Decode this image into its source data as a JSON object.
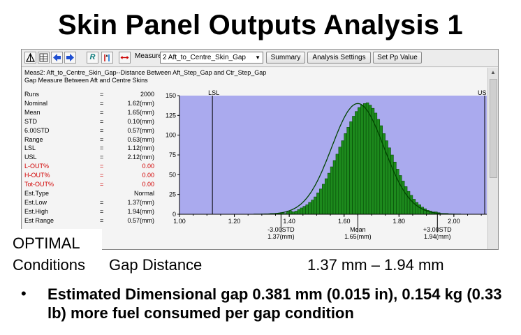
{
  "slide": {
    "title": "Skin Panel Outputs Analysis 1",
    "optimal_line1": "OPTIMAL",
    "optimal_line2": "Conditions",
    "gap_label": "Gap Distance",
    "gap_range": "1.37 mm – 1.94 mm",
    "bullet": "Estimated Dimensional gap 0.381 mm (0.015 in), 0.154 kg (0.33 lb) more fuel consumed per gap condition"
  },
  "toolbar": {
    "icons": [
      "histogram-icon",
      "table-icon",
      "arrow-left-icon",
      "arrow-right-icon",
      "r-icon",
      "bars-arrow-icon",
      "spread-arrows-icon"
    ],
    "measure_label": "Measure:",
    "measure_value": "2 Aft_to_Centre_Skin_Gap",
    "summary_label": "Summary",
    "analysis_settings_label": "Analysis Settings",
    "set_pp_label": "Set Pp Value"
  },
  "measure": {
    "line1": "Meas2: Aft_to_Centre_Skin_Gap--Distance Between Aft_Step_Gap and Ctr_Step_Gap",
    "line2": "Gap Measure Between Aft and Centre Skins"
  },
  "stats": [
    {
      "label": "Runs",
      "eq": "=",
      "value": "2000",
      "color": "black"
    },
    {
      "label": "Nominal",
      "eq": "=",
      "value": "1.62(mm)",
      "color": "black"
    },
    {
      "label": "Mean",
      "eq": "=",
      "value": "1.65(mm)",
      "color": "black"
    },
    {
      "label": "STD",
      "eq": "=",
      "value": "0.10(mm)",
      "color": "black"
    },
    {
      "label": "6.00STD",
      "eq": "=",
      "value": "0.57(mm)",
      "color": "black"
    },
    {
      "label": "Range",
      "eq": "=",
      "value": "0.63(mm)",
      "color": "black"
    },
    {
      "label": "LSL",
      "eq": "=",
      "value": "1.12(mm)",
      "color": "black"
    },
    {
      "label": "USL",
      "eq": "=",
      "value": "2.12(mm)",
      "color": "black"
    },
    {
      "label": "L-OUT%",
      "eq": "=",
      "value": "0.00",
      "color": "red"
    },
    {
      "label": "H-OUT%",
      "eq": "=",
      "value": "0.00",
      "color": "red"
    },
    {
      "label": "Tot-OUT%",
      "eq": "=",
      "value": "0.00",
      "color": "red"
    },
    {
      "label": "Est.Type",
      "eq": "",
      "value": "Normal",
      "color": "black"
    },
    {
      "label": "Est.Low",
      "eq": "=",
      "value": "1.37(mm)",
      "color": "black"
    },
    {
      "label": "Est.High",
      "eq": "=",
      "value": "1.94(mm)",
      "color": "black"
    },
    {
      "label": "Est Range",
      "eq": "=",
      "value": "0.57(mm)",
      "color": "black"
    }
  ],
  "chart_data": {
    "type": "bar",
    "xlim": [
      1.0,
      2.12
    ],
    "ylim": [
      0,
      150
    ],
    "x_ticks": [
      "1.00",
      "1.20",
      "1.40",
      "1.60",
      "1.80",
      "2.00"
    ],
    "y_ticks": [
      "0",
      "25",
      "50",
      "75",
      "100",
      "125",
      "150"
    ],
    "bin_width": 0.01,
    "bin_start": 1.33,
    "counts": [
      1,
      0,
      1,
      1,
      2,
      1,
      3,
      4,
      3,
      4,
      6,
      8,
      10,
      12,
      15,
      18,
      22,
      27,
      32,
      38,
      45,
      52,
      60,
      68,
      76,
      85,
      93,
      102,
      110,
      117,
      124,
      130,
      135,
      138,
      140,
      141,
      138,
      134,
      128,
      120,
      112,
      102,
      93,
      84,
      75,
      66,
      57,
      49,
      42,
      35,
      29,
      24,
      19,
      15,
      12,
      9,
      7,
      5,
      4,
      3,
      3,
      2,
      1,
      1,
      1
    ],
    "lsl": {
      "value": 1.12,
      "label": "LSL"
    },
    "usl": {
      "value": 2.12,
      "label": "US"
    },
    "curve": {
      "mean": 1.65,
      "std": 0.095,
      "peak": 140
    },
    "markers": [
      {
        "value": 1.37,
        "top": "-3.00STD",
        "bottom": "1.37(mm)"
      },
      {
        "value": 1.65,
        "top": "Mean",
        "bottom": "1.65(mm)"
      },
      {
        "value": 1.94,
        "top": "+3.00STD",
        "bottom": "1.94(mm)"
      }
    ],
    "colors": {
      "background": "#aaaaee",
      "bar": "#1d8a1d",
      "bar_edge": "#003d00",
      "curve": "#004400"
    }
  }
}
